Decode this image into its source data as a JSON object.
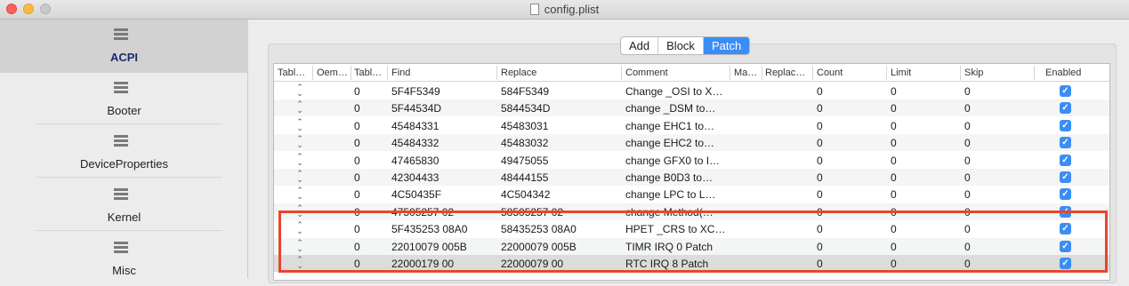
{
  "window": {
    "title": "config.plist"
  },
  "sidebar": {
    "items": [
      {
        "label": "ACPI",
        "selected": true,
        "icon": "list-icon"
      },
      {
        "label": "Booter",
        "selected": false,
        "icon": "list-icon"
      },
      {
        "label": "DeviceProperties",
        "selected": false,
        "icon": "list-icon"
      },
      {
        "label": "Kernel",
        "selected": false,
        "icon": "list-icon"
      },
      {
        "label": "Misc",
        "selected": false,
        "icon": "list-icon"
      }
    ]
  },
  "segmented": {
    "add": "Add",
    "block": "Block",
    "patch": "Patch",
    "active": "Patch"
  },
  "table": {
    "headers": [
      "Tabl…",
      "Oem…",
      "Tabl…",
      "Find",
      "Replace",
      "Comment",
      "Ma…",
      "Replac…",
      "Count",
      "Limit",
      "Skip",
      "Enabled"
    ],
    "rows": [
      {
        "table_count": "0",
        "find": "5F4F5349",
        "replace": "584F5349",
        "comment": "Change _OSI to X…",
        "count": "0",
        "limit": "0",
        "skip": "0",
        "enabled": true
      },
      {
        "table_count": "0",
        "find": "5F44534D",
        "replace": "5844534D",
        "comment": "change _DSM to…",
        "count": "0",
        "limit": "0",
        "skip": "0",
        "enabled": true
      },
      {
        "table_count": "0",
        "find": "45484331",
        "replace": "45483031",
        "comment": "change EHC1 to…",
        "count": "0",
        "limit": "0",
        "skip": "0",
        "enabled": true
      },
      {
        "table_count": "0",
        "find": "45484332",
        "replace": "45483032",
        "comment": "change EHC2 to…",
        "count": "0",
        "limit": "0",
        "skip": "0",
        "enabled": true
      },
      {
        "table_count": "0",
        "find": "47465830",
        "replace": "49475055",
        "comment": "change GFX0 to I…",
        "count": "0",
        "limit": "0",
        "skip": "0",
        "enabled": true
      },
      {
        "table_count": "0",
        "find": "42304433",
        "replace": "48444155",
        "comment": "change B0D3 to…",
        "count": "0",
        "limit": "0",
        "skip": "0",
        "enabled": true
      },
      {
        "table_count": "0",
        "find": "4C50435F",
        "replace": "4C504342",
        "comment": "change LPC to L…",
        "count": "0",
        "limit": "0",
        "skip": "0",
        "enabled": true
      },
      {
        "table_count": "0",
        "find": "47505257 02",
        "replace": "58505257 02",
        "comment": "change Method(…",
        "count": "0",
        "limit": "0",
        "skip": "0",
        "enabled": true
      },
      {
        "table_count": "0",
        "find": "5F435253 08A0",
        "replace": "58435253 08A0",
        "comment": "HPET _CRS to XC…",
        "count": "0",
        "limit": "0",
        "skip": "0",
        "enabled": true
      },
      {
        "table_count": "0",
        "find": "22010079 005B",
        "replace": "22000079 005B",
        "comment": "TIMR IRQ 0 Patch",
        "count": "0",
        "limit": "0",
        "skip": "0",
        "enabled": true
      },
      {
        "table_count": "0",
        "find": "22000179 00",
        "replace": "22000079 00",
        "comment": "RTC IRQ 8 Patch",
        "count": "0",
        "limit": "0",
        "skip": "0",
        "enabled": true
      }
    ]
  },
  "colors": {
    "accent": "#3b8df5",
    "highlight_box": "#e8452d"
  }
}
